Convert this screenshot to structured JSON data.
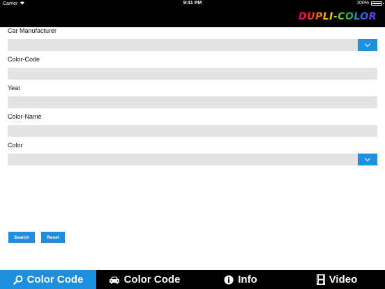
{
  "status_bar": {
    "carrier": "Carrier",
    "time": "9:41 PM",
    "battery": "100%"
  },
  "header": {
    "logo_text": "DUPLI-COLOR"
  },
  "form": {
    "fields": [
      {
        "label": "Car Manufacturer",
        "type": "select",
        "value": ""
      },
      {
        "label": "Color-Code",
        "type": "text",
        "value": ""
      },
      {
        "label": "Year",
        "type": "text",
        "value": ""
      },
      {
        "label": "Color-Name",
        "type": "text",
        "value": ""
      },
      {
        "label": "Color",
        "type": "select",
        "value": ""
      }
    ],
    "search_label": "Search",
    "reset_label": "Reset"
  },
  "tabs": [
    {
      "label": "Color Code",
      "icon": "search-icon",
      "active": true
    },
    {
      "label": "Color Code",
      "icon": "car-icon",
      "active": false
    },
    {
      "label": "Info",
      "icon": "info-icon",
      "active": false
    },
    {
      "label": "Video",
      "icon": "film-icon",
      "active": false
    }
  ],
  "colors": {
    "accent": "#1e8fe0",
    "field_bg": "#e3e3e4",
    "bar_bg": "#000000"
  }
}
